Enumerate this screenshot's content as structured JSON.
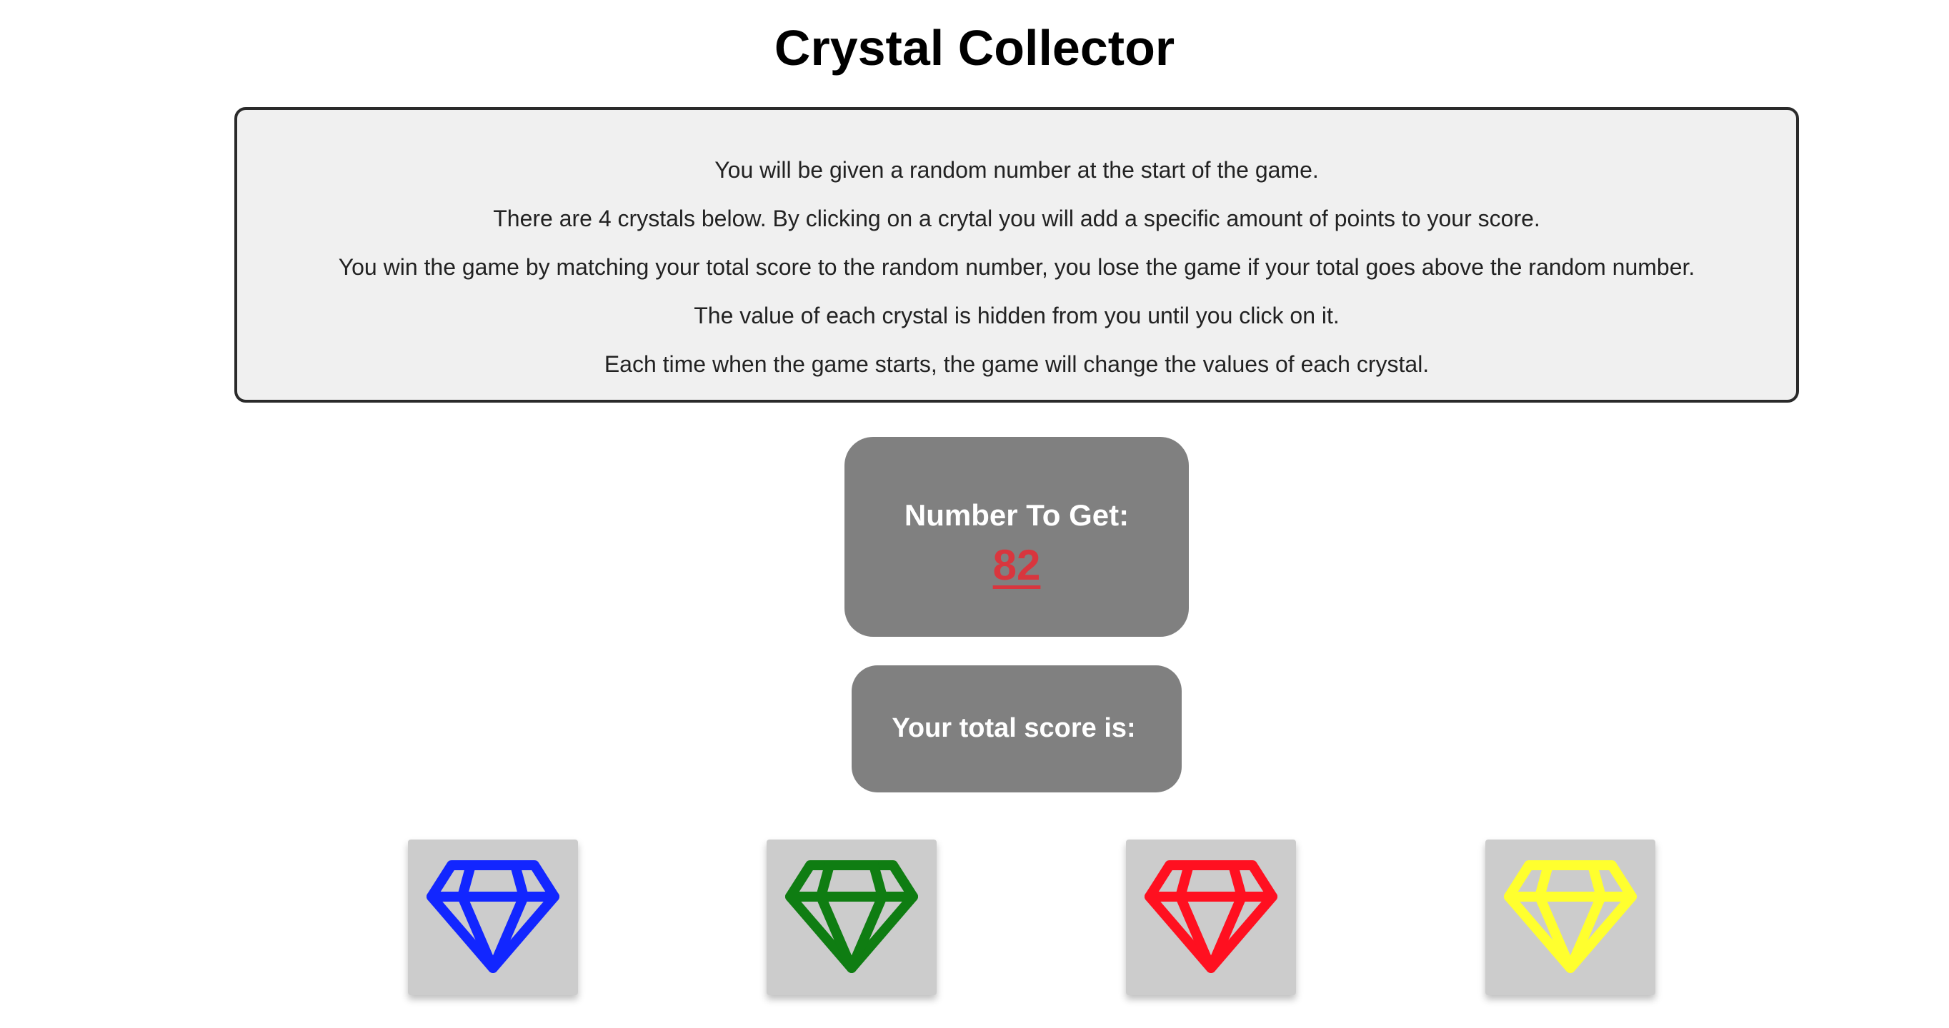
{
  "title": "Crystal Collector",
  "instructions": [
    "You will be given a random number at the start of the game.",
    "There are 4 crystals below. By clicking on a crytal you will add a specific amount of points to your score.",
    "You win the game by matching your total score to the random number, you lose the game if your total goes above the random number.",
    "The value of each crystal is hidden from you until you click on it.",
    "Each time when the game starts, the game will change the values of each crystal."
  ],
  "target": {
    "label": "Number To Get:",
    "value": "82"
  },
  "score": {
    "label": "Your total score is:",
    "value": ""
  },
  "crystals": [
    {
      "name": "blue",
      "color": "#1226ff",
      "icon": "diamond-icon"
    },
    {
      "name": "green",
      "color": "#0f7d12",
      "icon": "diamond-icon"
    },
    {
      "name": "red",
      "color": "#ff1020",
      "icon": "diamond-icon"
    },
    {
      "name": "yellow",
      "color": "#ffff2e",
      "icon": "diamond-icon"
    }
  ],
  "colors": {
    "panel_gray": "#808080",
    "instructions_bg": "#f0f0f0",
    "target_number": "#d9363e",
    "crystal_tile": "#cccccc"
  }
}
